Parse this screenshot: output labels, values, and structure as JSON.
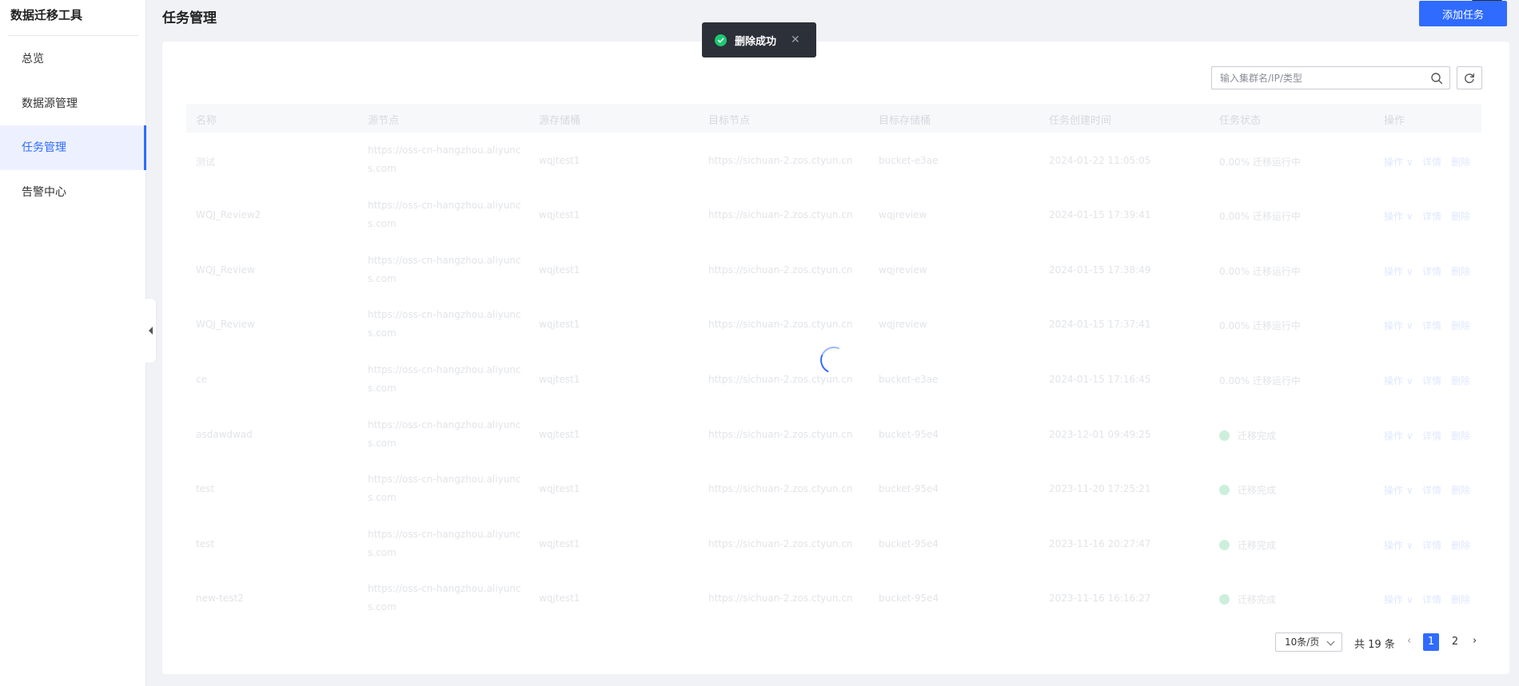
{
  "app": {
    "title": "数据迁移工具"
  },
  "sidebar": {
    "items": [
      {
        "label": "总览"
      },
      {
        "label": "数据源管理"
      },
      {
        "label": "任务管理"
      },
      {
        "label": "告警中心"
      }
    ]
  },
  "header": {
    "title": "任务管理",
    "add_button": "添加任务"
  },
  "toast": {
    "message": "删除成功",
    "close": "✕"
  },
  "search": {
    "placeholder": "输入集群名/IP/类型"
  },
  "table": {
    "columns": [
      "名称",
      "源节点",
      "源存储桶",
      "目标节点",
      "目标存储桶",
      "任务创建时间",
      "任务状态",
      "操作"
    ],
    "row_actions": {
      "op": "操作 ∨",
      "detail": "详情",
      "delete": "删除"
    },
    "rows": [
      {
        "name": "测试",
        "src_node_l1": "https://oss-cn-hangzhou.aliyunc",
        "src_node_l2": "s.com",
        "src_bucket": "wqjtest1",
        "dst_node": "https://sichuan-2.zos.ctyun.cn",
        "dst_bucket": "bucket-e3ae",
        "created": "2024-01-22 11:05:05",
        "status": "0.00% 迁移运行中"
      },
      {
        "name": "WQJ_Review2",
        "src_node_l1": "https://oss-cn-hangzhou.aliyunc",
        "src_node_l2": "s.com",
        "src_bucket": "wqjtest1",
        "dst_node": "https://sichuan-2.zos.ctyun.cn",
        "dst_bucket": "wqjreview",
        "created": "2024-01-15 17:39:41",
        "status": "0.00% 迁移运行中"
      },
      {
        "name": "WQJ_Review",
        "src_node_l1": "https://oss-cn-hangzhou.aliyunc",
        "src_node_l2": "s.com",
        "src_bucket": "wqjtest1",
        "dst_node": "https://sichuan-2.zos.ctyun.cn",
        "dst_bucket": "wqjreview",
        "created": "2024-01-15 17:38:49",
        "status": "0.00% 迁移运行中"
      },
      {
        "name": "WQJ_Review",
        "src_node_l1": "https://oss-cn-hangzhou.aliyunc",
        "src_node_l2": "s.com",
        "src_bucket": "wqjtest1",
        "dst_node": "https://sichuan-2.zos.ctyun.cn",
        "dst_bucket": "wqjreview",
        "created": "2024-01-15 17:37:41",
        "status": "0.00% 迁移运行中"
      },
      {
        "name": "ce",
        "src_node_l1": "https://oss-cn-hangzhou.aliyunc",
        "src_node_l2": "s.com",
        "src_bucket": "wqjtest1",
        "dst_node": "https://sichuan-2.zos.ctyun.cn",
        "dst_bucket": "bucket-e3ae",
        "created": "2024-01-15 17:16:45",
        "status": "0.00% 迁移运行中"
      },
      {
        "name": "asdawdwad",
        "src_node_l1": "https://oss-cn-hangzhou.aliyunc",
        "src_node_l2": "s.com",
        "src_bucket": "wqjtest1",
        "dst_node": "https://sichuan-2.zos.ctyun.cn",
        "dst_bucket": "bucket-95e4",
        "created": "2023-12-01 09:49:25",
        "status": "迁移完成"
      },
      {
        "name": "test",
        "src_node_l1": "https://oss-cn-hangzhou.aliyunc",
        "src_node_l2": "s.com",
        "src_bucket": "wqjtest1",
        "dst_node": "https://sichuan-2.zos.ctyun.cn",
        "dst_bucket": "bucket-95e4",
        "created": "2023-11-20 17:25:21",
        "status": "迁移完成"
      },
      {
        "name": "test",
        "src_node_l1": "https://oss-cn-hangzhou.aliyunc",
        "src_node_l2": "s.com",
        "src_bucket": "wqjtest1",
        "dst_node": "https://sichuan-2.zos.ctyun.cn",
        "dst_bucket": "bucket-95e4",
        "created": "2023-11-16 20:27:47",
        "status": "迁移完成"
      },
      {
        "name": "new-test2",
        "src_node_l1": "https://oss-cn-hangzhou.aliyunc",
        "src_node_l2": "s.com",
        "src_bucket": "wqjtest1",
        "dst_node": "https://sichuan-2.zos.ctyun.cn",
        "dst_bucket": "bucket-95e4",
        "created": "2023-11-16 16:16:27",
        "status": "迁移完成"
      }
    ]
  },
  "pagination": {
    "page_size": "10条/页",
    "total": "共 19 条",
    "prev": "‹",
    "next": "›",
    "pages": [
      "1",
      "2"
    ]
  }
}
